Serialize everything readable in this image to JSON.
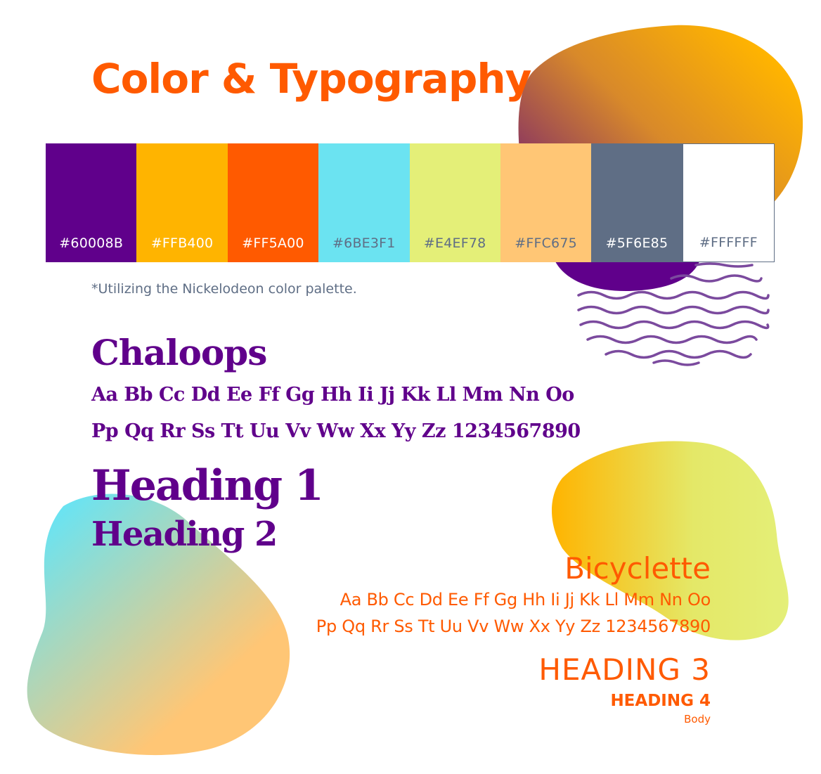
{
  "title": "Color & Typography",
  "palette": [
    {
      "hex": "#60008B",
      "color": "#60008B",
      "text_color": "#FFFFFF"
    },
    {
      "hex": "#FFB400",
      "color": "#FFB400",
      "text_color": "#FFFFFF"
    },
    {
      "hex": "#FF5A00",
      "color": "#FF5A00",
      "text_color": "#FFFFFF"
    },
    {
      "hex": "#6BE3F1",
      "color": "#6BE3F1",
      "text_color": "#5F6E85"
    },
    {
      "hex": "#E4EF78",
      "color": "#E4EF78",
      "text_color": "#5F6E85"
    },
    {
      "hex": "#FFC675",
      "color": "#FFC675",
      "text_color": "#5F6E85"
    },
    {
      "hex": "#5F6E85",
      "color": "#5F6E85",
      "text_color": "#FFFFFF"
    },
    {
      "hex": "#FFFFFF",
      "color": "#FFFFFF",
      "text_color": "#5F6E85"
    }
  ],
  "note": "*Utilizing the Nickelodeon color palette.",
  "font1": {
    "name": "Chaloops",
    "line1": "Aa Bb Cc Dd Ee Ff Gg Hh Ii Jj Kk Ll Mm  Nn Oo",
    "line2": "Pp Qq Rr Ss Tt Uu Vv Ww Xx Yy Zz  1234567890",
    "heading1": "Heading 1",
    "heading2": "Heading 2"
  },
  "font2": {
    "name": "Bicyclette",
    "line1": "Aa Bb Cc Dd Ee Ff Gg Hh Ii Jj Kk Ll Mm Nn Oo",
    "line2": "Pp Qq Rr Ss Tt Uu Vv Ww Xx Yy Zz 1234567890",
    "heading3": "HEADING 3",
    "heading4": "HEADING 4",
    "body": "Body"
  }
}
